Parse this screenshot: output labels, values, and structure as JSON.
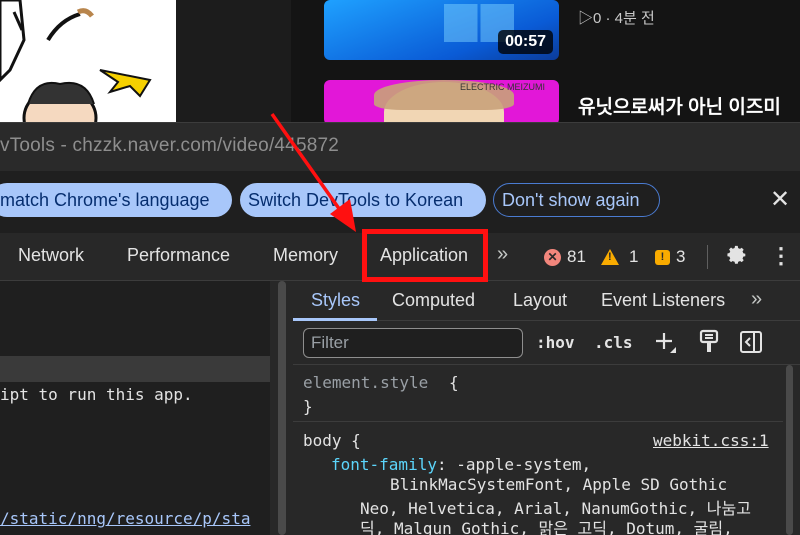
{
  "background_page": {
    "video1": {
      "duration": "00:57",
      "meta": "▷0 · 4분 전"
    },
    "video2": {
      "title": "유닛으로써가 아닌 이즈미",
      "thumb_caption": "ELECTRIC MEIZUMI"
    }
  },
  "devtools": {
    "window_title": "vTools - chzzk.naver.com/video/445872",
    "infobar": {
      "match_button": "match Chrome's language",
      "switch_button": "Switch DevTools to Korean",
      "dont_show_button": "Don't show again",
      "close_icon": "✕"
    },
    "tabs": [
      {
        "label": "Network"
      },
      {
        "label": "Performance"
      },
      {
        "label": "Memory"
      },
      {
        "label": "Application"
      }
    ],
    "more_tabs_icon": "»",
    "counters": {
      "errors": "81",
      "warnings": "1",
      "issues": "3"
    },
    "left_pane": {
      "console_message": "ipt to run this app.",
      "resource_link": "/static/nng/resource/p/sta"
    },
    "styles_panel": {
      "subtabs": [
        {
          "label": "Styles"
        },
        {
          "label": "Computed"
        },
        {
          "label": "Layout"
        },
        {
          "label": "Event Listeners"
        }
      ],
      "more_subtabs_icon": "»",
      "filter_placeholder": "Filter",
      "hov_label": ":hov",
      "cls_label": ".cls",
      "element_style_selector": "element.style",
      "open_brace": "{",
      "close_brace": "}",
      "body_selector": "body {",
      "source_link": "webkit.css:1",
      "property_name": "font-family",
      "property_value_1": ": -apple-system,",
      "property_value_2": "BlinkMacSystemFont, Apple SD Gothic",
      "property_value_3": "Neo, Helvetica, Arial, NanumGothic, 나눔고",
      "property_value_4": "딕, Malgun Gothic, 맑은 고딕, Dotum, 굴림,"
    }
  },
  "colors": {
    "accent": "#a8c7fa",
    "annotation_red": "#ff1010",
    "error": "#f2867c",
    "warning": "#f9ab00"
  }
}
